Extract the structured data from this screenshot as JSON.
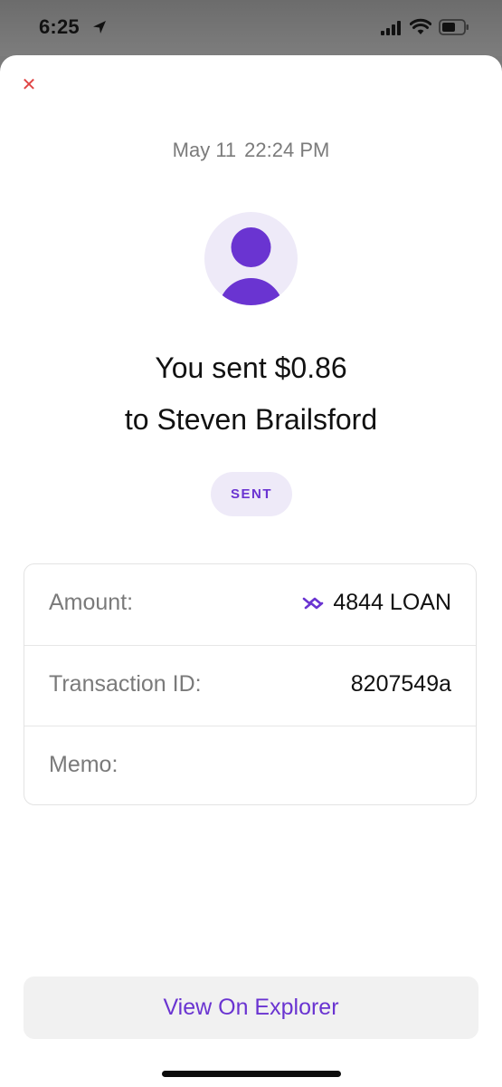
{
  "status_bar": {
    "time": "6:25",
    "icons": [
      "location-arrow-icon",
      "cellular-signal-icon",
      "wifi-icon",
      "battery-icon"
    ]
  },
  "header": {
    "close_icon": "close-icon",
    "close_glyph": "✕"
  },
  "transaction": {
    "date": "May 11",
    "time": "22:24 PM",
    "avatar_icon": "person-icon",
    "headline_line1": "You sent $0.86",
    "headline_line2": "to Steven Brailsford",
    "status": "SENT"
  },
  "details": {
    "amount_label": "Amount:",
    "amount_value": "4844 LOAN",
    "amount_icon": "loan-token-icon",
    "transaction_id_label": "Transaction ID:",
    "transaction_id_value": "8207549a",
    "memo_label": "Memo:",
    "memo_value": ""
  },
  "footer": {
    "explorer_button": "View On Explorer"
  },
  "colors": {
    "accent": "#6a34d1",
    "avatar_bg": "#eeeaf8",
    "close": "#e04646"
  }
}
